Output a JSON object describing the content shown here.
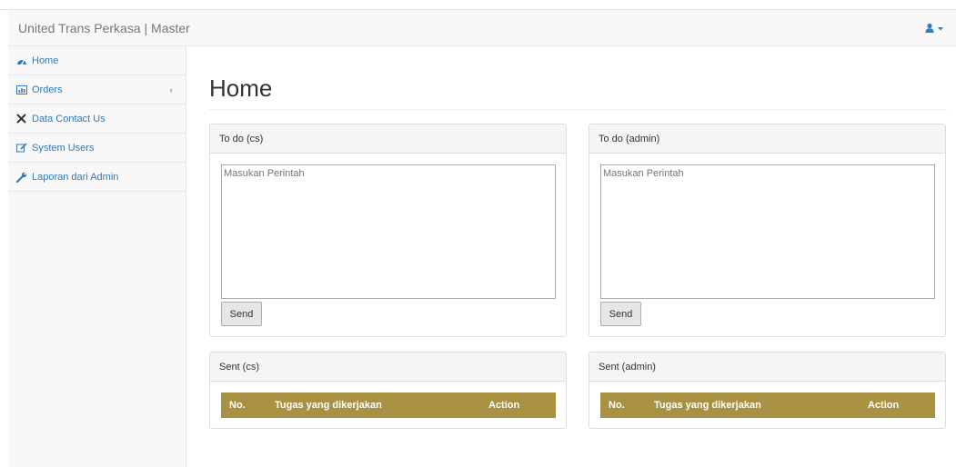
{
  "navbar": {
    "brand": "United Trans Perkasa | Master",
    "user_icon": "user-icon"
  },
  "sidebar": {
    "items": [
      {
        "label": "Home",
        "icon": "dashboard-icon"
      },
      {
        "label": "Orders",
        "icon": "bar-chart-icon",
        "expand_icon": "chevron-left-icon"
      },
      {
        "label": "Data Contact Us",
        "icon": "tools-icon"
      },
      {
        "label": "System Users",
        "icon": "edit-icon"
      },
      {
        "label": "Laporan dari Admin",
        "icon": "wrench-icon"
      }
    ]
  },
  "main": {
    "title": "Home",
    "todo_cs": {
      "heading": "To do (cs)",
      "placeholder": "Masukan Perintah",
      "button": "Send"
    },
    "todo_admin": {
      "heading": "To do (admin)",
      "placeholder": "Masukan Perintah",
      "button": "Send"
    },
    "sent_cs": {
      "heading": "Sent (cs)",
      "columns": [
        "No.",
        "Tugas yang dikerjakan",
        "Action"
      ]
    },
    "sent_admin": {
      "heading": "Sent (admin)",
      "columns": [
        "No.",
        "Tugas yang dikerjakan",
        "Action"
      ]
    }
  },
  "colors": {
    "table_header": "#a89142",
    "link": "#337ab7",
    "navbar_bg": "#f8f8f8"
  }
}
